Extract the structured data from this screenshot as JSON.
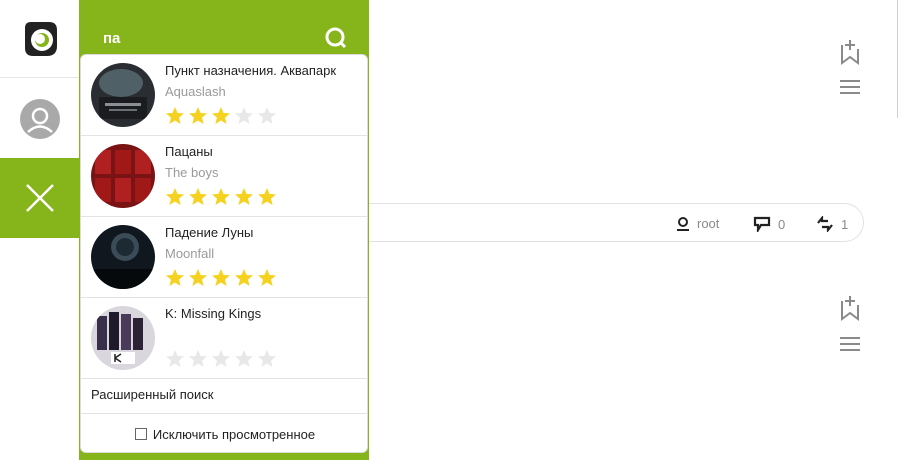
{
  "search": {
    "query": "па"
  },
  "results": [
    {
      "title": "Пункт назначения. Аквапарк",
      "original": "Aquaslash",
      "rating": 3
    },
    {
      "title": "Пацаны",
      "original": "The boys",
      "rating": 5
    },
    {
      "title": "Падение Луны",
      "original": "Moonfall",
      "rating": 5
    },
    {
      "title": "K: Missing Kings",
      "original": "",
      "rating": 0
    }
  ],
  "advanced_search_label": "Расширенный поиск",
  "exclude_watched_label": "Исключить просмотренное",
  "post_meta": {
    "author": "root",
    "comments": "0",
    "reposts": "1"
  },
  "colors": {
    "accent": "#85b51a",
    "star_on": "#f5d21f",
    "star_off": "#e8e8e8"
  },
  "icons": [
    "logo-icon",
    "user-icon",
    "close-icon",
    "search-icon",
    "bookmark-add-icon",
    "menu-icon",
    "comment-icon",
    "repost-icon"
  ]
}
